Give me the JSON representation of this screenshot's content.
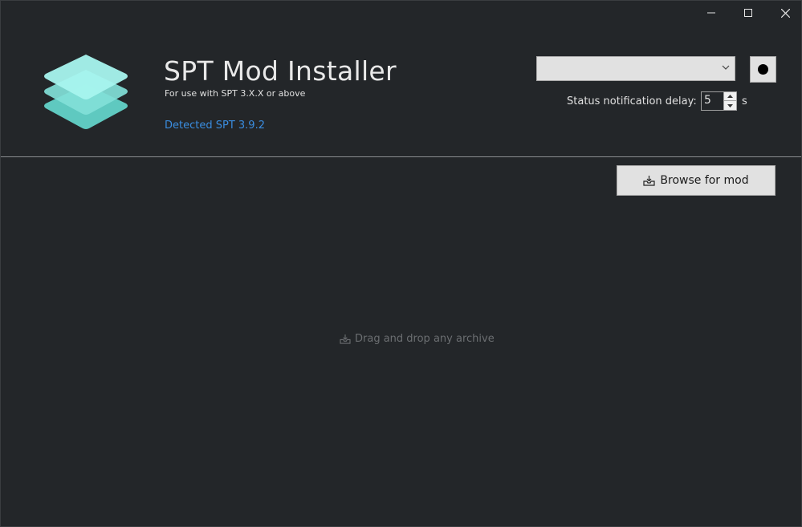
{
  "window": {
    "title": "",
    "controls": {
      "minimize": "minimize-icon",
      "maximize": "maximize-icon",
      "close": "close-icon"
    }
  },
  "header": {
    "logo_icon": "stacked-layers-icon",
    "title": "SPT Mod Installer",
    "subtitle": "For use with SPT 3.X.X or above",
    "detected": "Detected SPT 3.9.2"
  },
  "settings": {
    "dropdown_value": "",
    "dot_button_icon": "record-dot-icon",
    "delay_label": "Status notification delay:",
    "delay_value": "5",
    "delay_unit": "s"
  },
  "actions": {
    "browse_label": "Browse for mod",
    "browse_icon": "inbox-tray-icon"
  },
  "dropzone": {
    "hint": "Drag and drop any archive",
    "hint_icon": "inbox-tray-icon"
  },
  "colors": {
    "background": "#232629",
    "accent_link": "#3a8de0",
    "logo_top": "#a8f4ee",
    "logo_mid": "#82e0d8",
    "logo_bottom": "#5fc9c0"
  }
}
